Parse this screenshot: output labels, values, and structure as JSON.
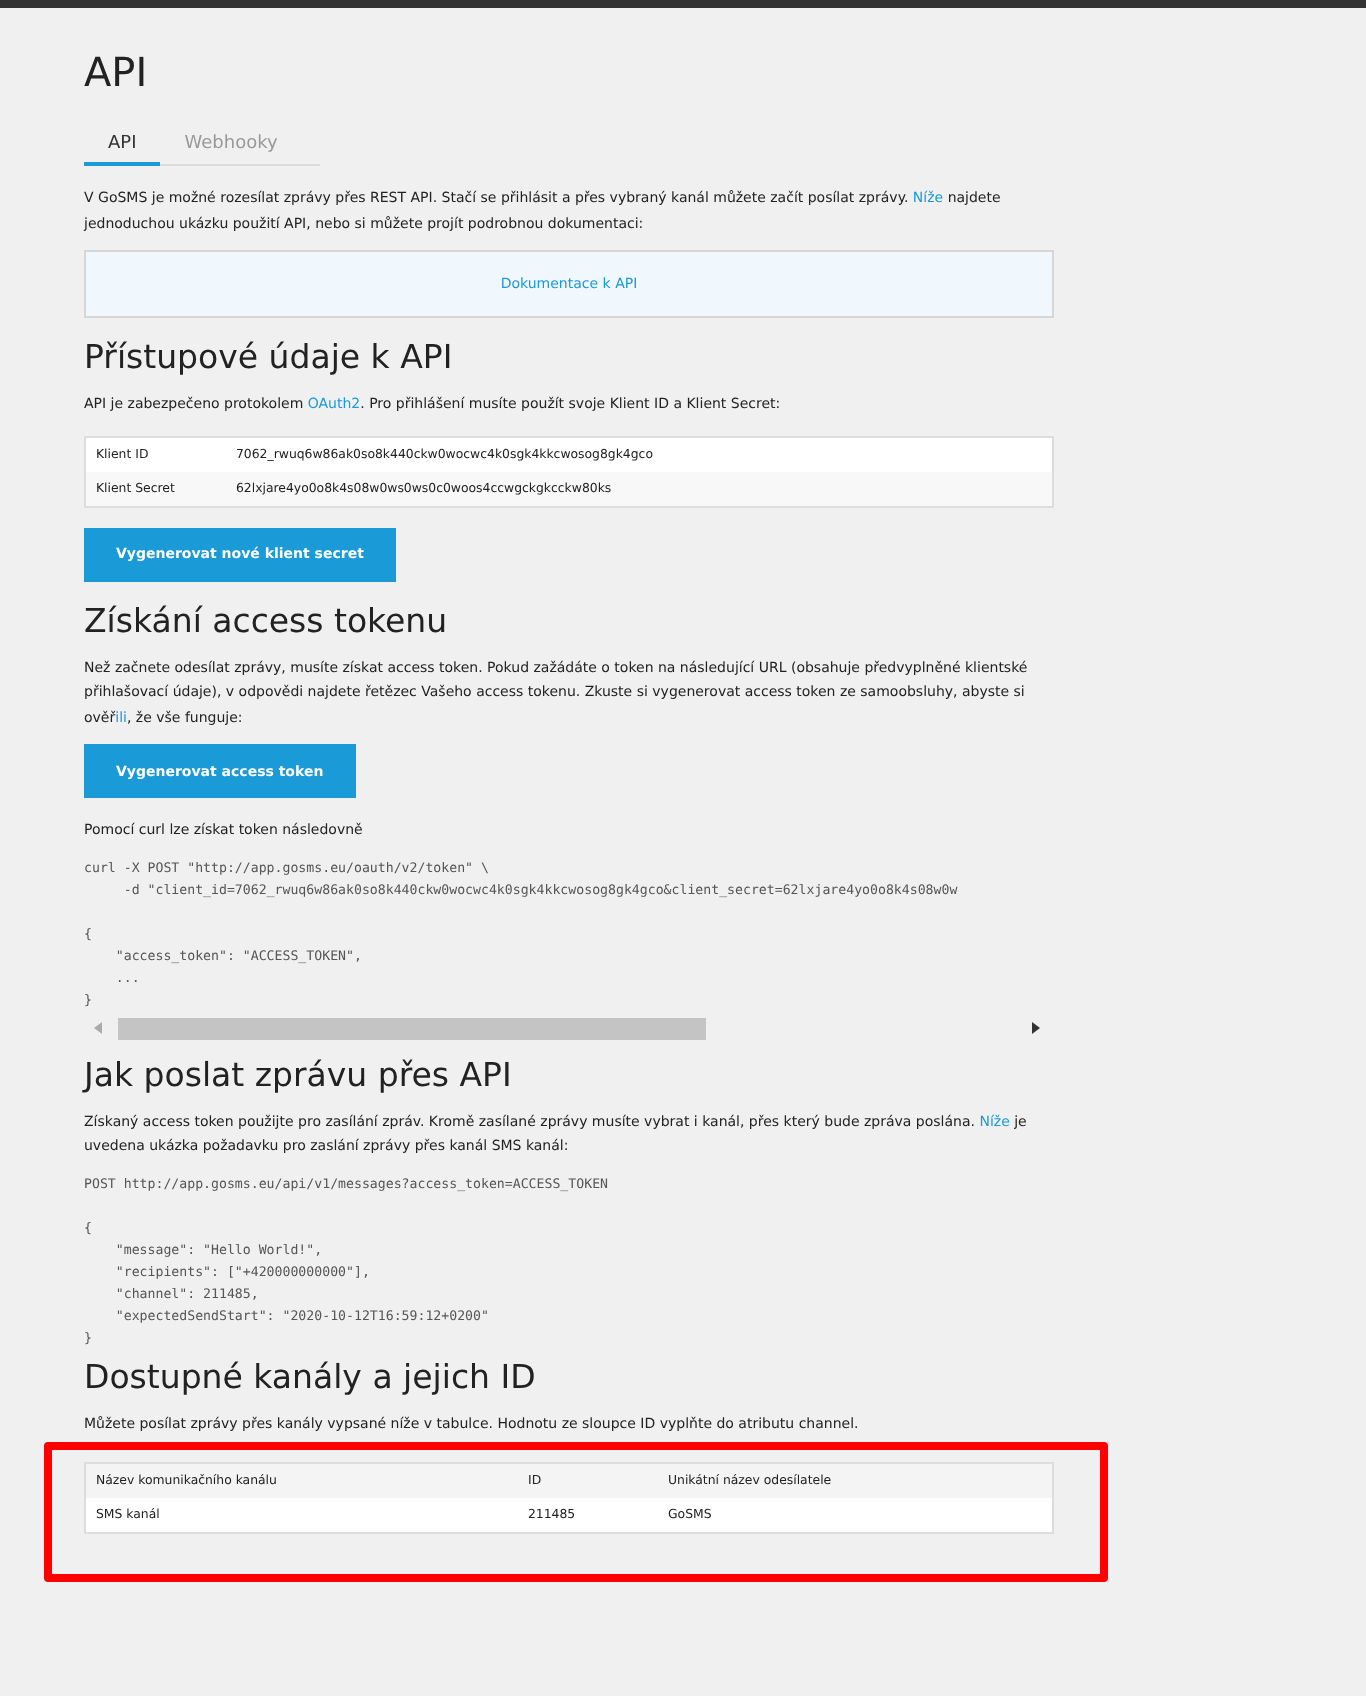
{
  "page": {
    "title": "API"
  },
  "tabs": [
    {
      "label": "API",
      "selected": true
    },
    {
      "label": "Webhooky",
      "selected": false
    }
  ],
  "intro": [
    {
      "text": "V GoSMS je možné rozesílat zprávy přes REST API. Stačí se přihlásit a přes vybraný kanál můžete začít posílat zprávy. "
    },
    {
      "text": "Níže",
      "link": true
    },
    {
      "text": " najdete jednoduchou ukázku použití API, nebo si můžete projít podrobnou dokumentaci:"
    }
  ],
  "docs_link": "Dokumentace k API",
  "credentials": {
    "heading": "Přístupové údaje k API",
    "text": [
      {
        "text": "API je zabezpečeno protokolem "
      },
      {
        "text": "OAuth2",
        "link": true
      },
      {
        "text": ". Pro přihlášení musíte použít svoje Klient ID a Klient Secret:"
      }
    ],
    "rows": [
      {
        "label": "Klient ID",
        "value": "7062_rwuq6w86ak0so8k440ckw0wocwc4k0sgk4kkcwosog8gk4gco"
      },
      {
        "label": "Klient Secret",
        "value": "62lxjare4yo0o8k4s08w0ws0ws0c0woos4ccwgckgkcckw80ks"
      }
    ],
    "button": "Vygenerovat nové klient secret"
  },
  "token": {
    "heading": "Získání access tokenu",
    "text": [
      {
        "text": "Než začnete odesílat zprávy, musíte získat access token. Pokud zažádáte o token na následující URL (obsahuje předvyplněné klientské přihlašovací údaje), v odpovědi najdete řetězec Vašeho access tokenu. Zkuste si vygenerovat access token ze samoobsluhy, abyste si ověř"
      },
      {
        "text": "ili",
        "link": true
      },
      {
        "text": ", že vše funguje:"
      }
    ],
    "button": "Vygenerovat access token",
    "curl_caption": "Pomocí curl lze získat token následovně",
    "code": [
      [
        "curl -X POST \"http://app.gosms.eu/oauth/v2/token\" \\",
        "     -d \"client_id=7062_rwuq6w86ak0so8k440ckw0wocwc4k0sgk4kkcwosog8gk4gco&client_secret=62lxjare4yo0o8k4s08w0w"
      ],
      [
        "{",
        "    \"access_token\": \"ACCESS_TOKEN\",",
        "    ...",
        "}"
      ]
    ]
  },
  "send": {
    "heading": "Jak poslat zprávu přes API",
    "text": [
      {
        "text": "Získaný access token použijte pro zasílání zpráv. Kromě zasílané zprávy musíte vybrat i kanál, přes který bude zpráva poslána. "
      },
      {
        "text": "Níže",
        "link": true
      },
      {
        "text": " je uvedena ukázka požadavku pro zaslání zprávy přes kanál SMS kanál:"
      }
    ],
    "code": [
      [
        "POST http://app.gosms.eu/api/v1/messages?access_token=ACCESS_TOKEN"
      ],
      [
        "{",
        "    \"message\": \"Hello World!\",",
        "    \"recipients\": [\"+420000000000\"],",
        "    \"channel\": 211485,",
        "    \"expectedSendStart\": \"2020-10-12T16:59:12+0200\"",
        "}"
      ]
    ]
  },
  "channels": {
    "heading": "Dostupné kanály a jejich ID",
    "text": "Můžete posílat zprávy přes kanály vypsané níže v tabulce. Hodnotu ze sloupce ID vyplňte do atributu channel.",
    "highlighted": true,
    "columns": [
      "Název komunikačního kanálu",
      "ID",
      "Unikátní název odesílatele"
    ],
    "rows": [
      [
        "SMS kanál",
        "211485",
        "GoSMS"
      ]
    ]
  }
}
